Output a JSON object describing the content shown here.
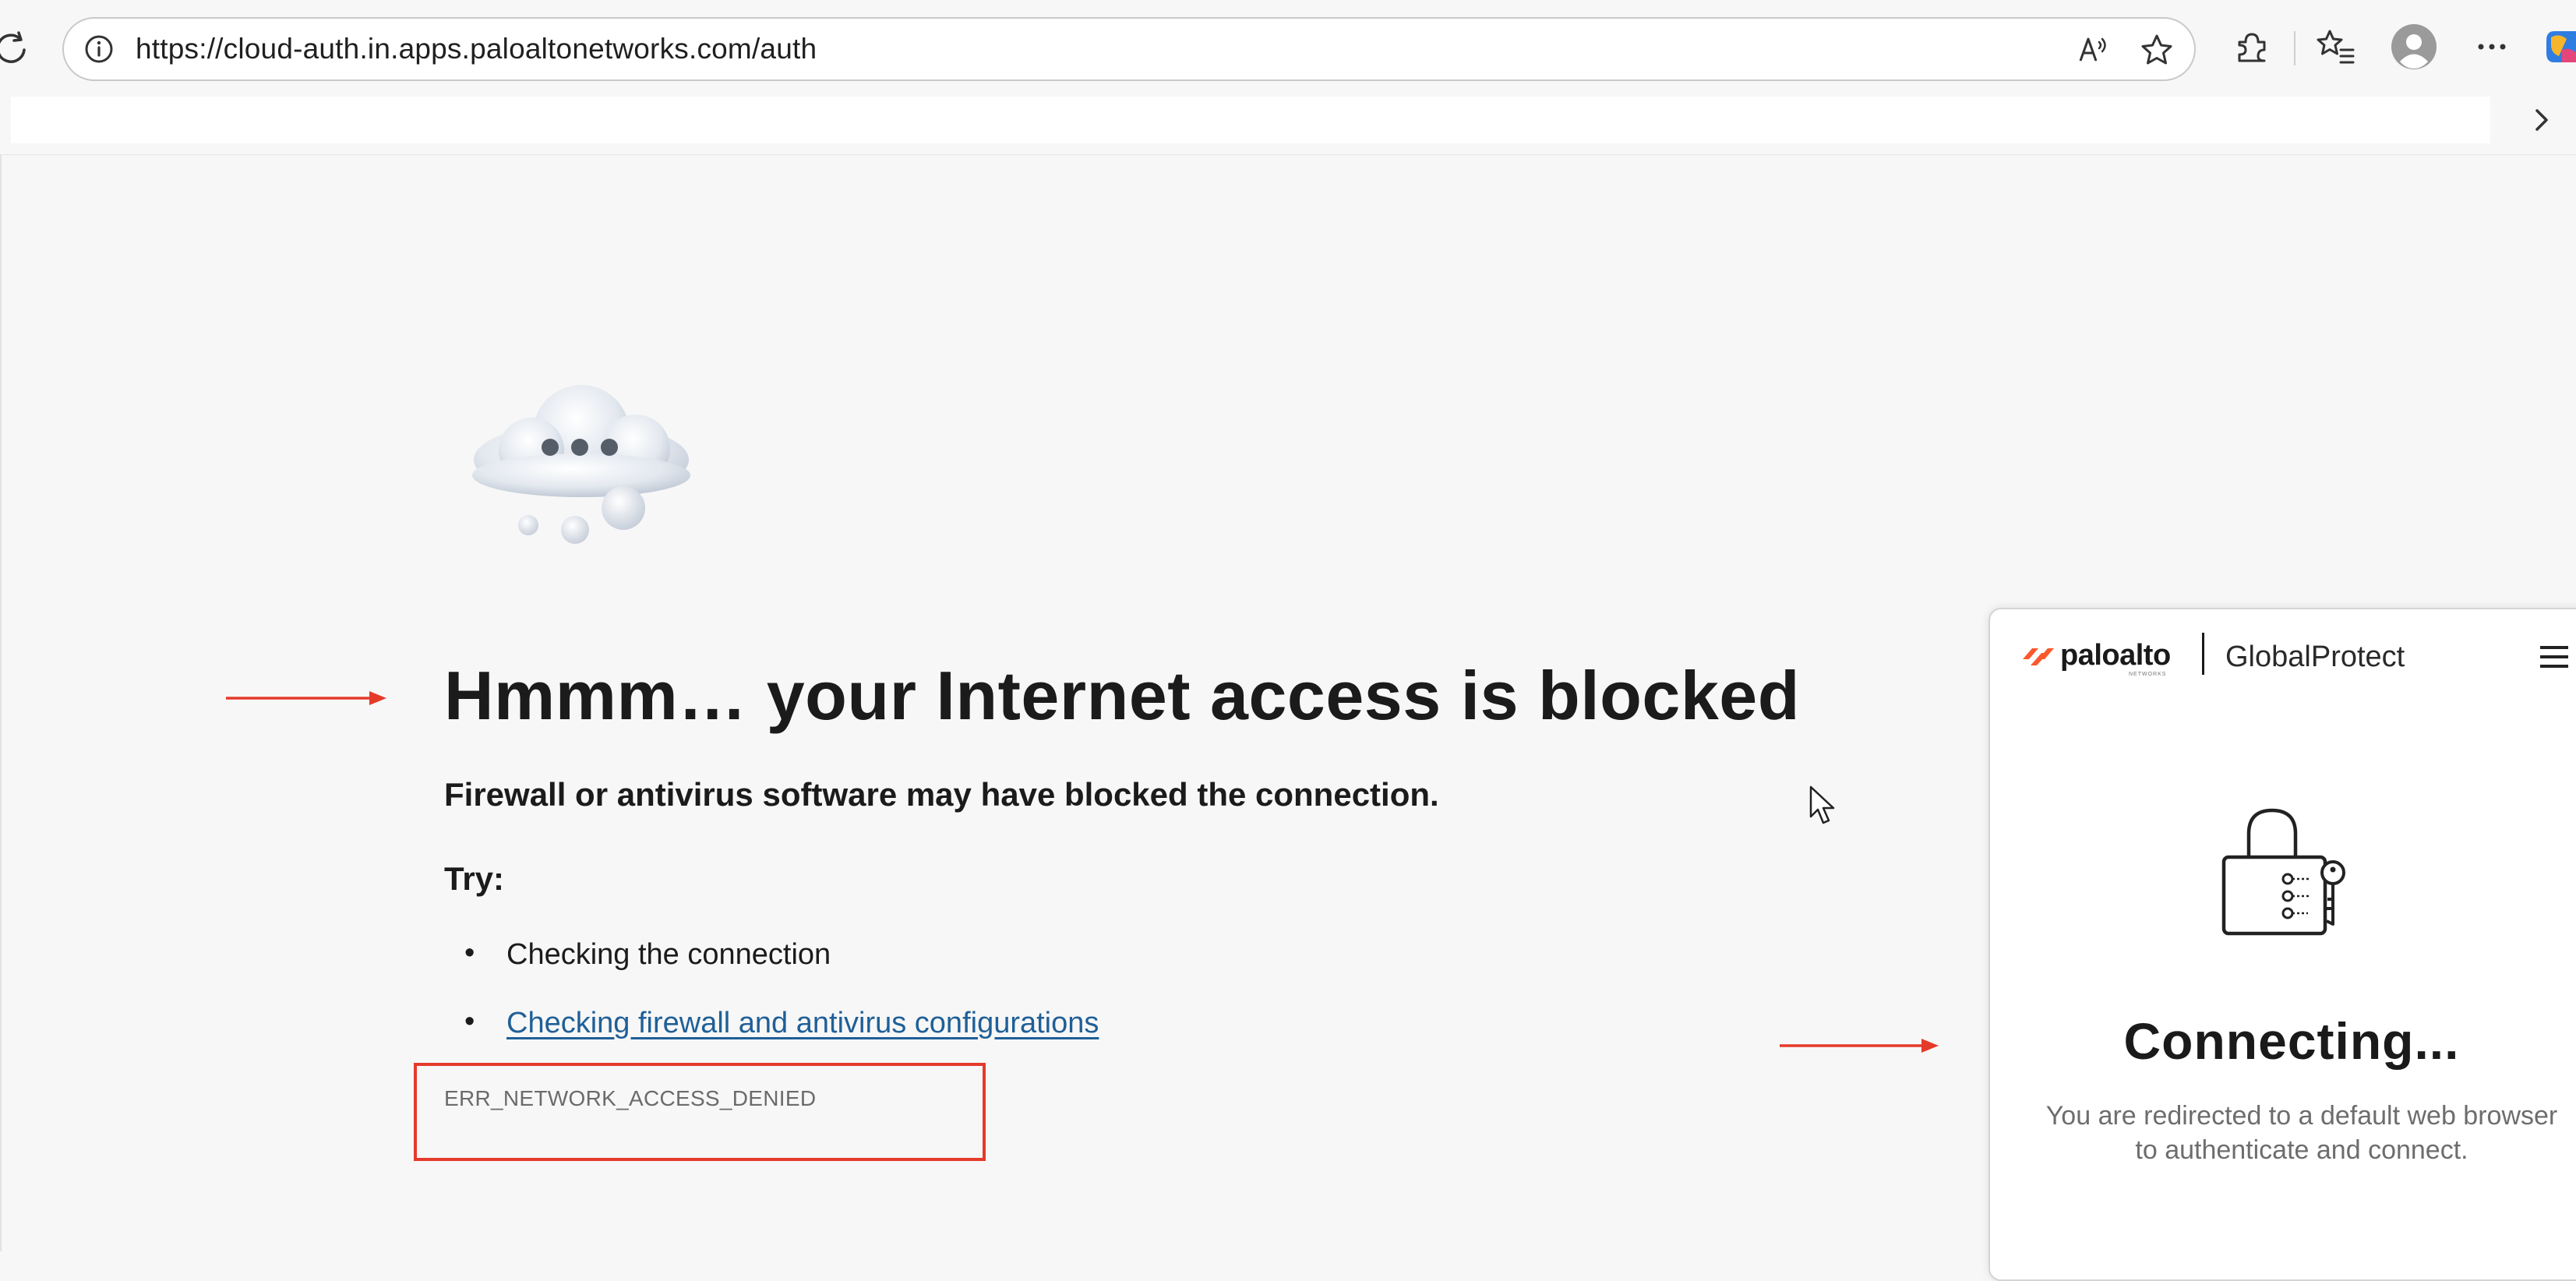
{
  "browser": {
    "url": "https://cloud-auth.in.apps.paloaltonetworks.com/auth",
    "toolbar_icons": [
      "reload-icon",
      "site-info-icon",
      "read-aloud-icon",
      "favorite-star-icon",
      "extensions-icon",
      "favorites-icon",
      "profile-avatar",
      "more-menu-icon",
      "copilot-icon"
    ],
    "favorites_bar": {
      "overflow_icon": "chevron-right-icon"
    }
  },
  "error_page": {
    "illustration": "cloud-ellipsis-icon",
    "title": "Hmmm… your Internet access is blocked",
    "subtitle": "Firewall or antivirus software may have blocked the connection.",
    "try_label": "Try:",
    "suggestions": [
      {
        "text": "Checking the connection",
        "is_link": false
      },
      {
        "text": "Checking firewall and antivirus configurations",
        "is_link": true
      }
    ],
    "error_code": "ERR_NETWORK_ACCESS_DENIED"
  },
  "annotations": {
    "arrow_color": "#e53a2a",
    "highlight_color": "#e53a2a"
  },
  "globalprotect": {
    "brand": "paloalto",
    "brand_sub": "NETWORKS",
    "product": "GlobalProtect",
    "menu_icon": "hamburger-menu-icon",
    "status_icon": "lock-with-key-icon",
    "status": "Connecting...",
    "message": "You are redirected to a default web browser to authenticate and connect.",
    "brand_color": "#fa582d"
  },
  "colors": {
    "page_bg": "#f7f7f7",
    "link": "#1f5f97",
    "error_code_text": "#6b6b6b"
  }
}
